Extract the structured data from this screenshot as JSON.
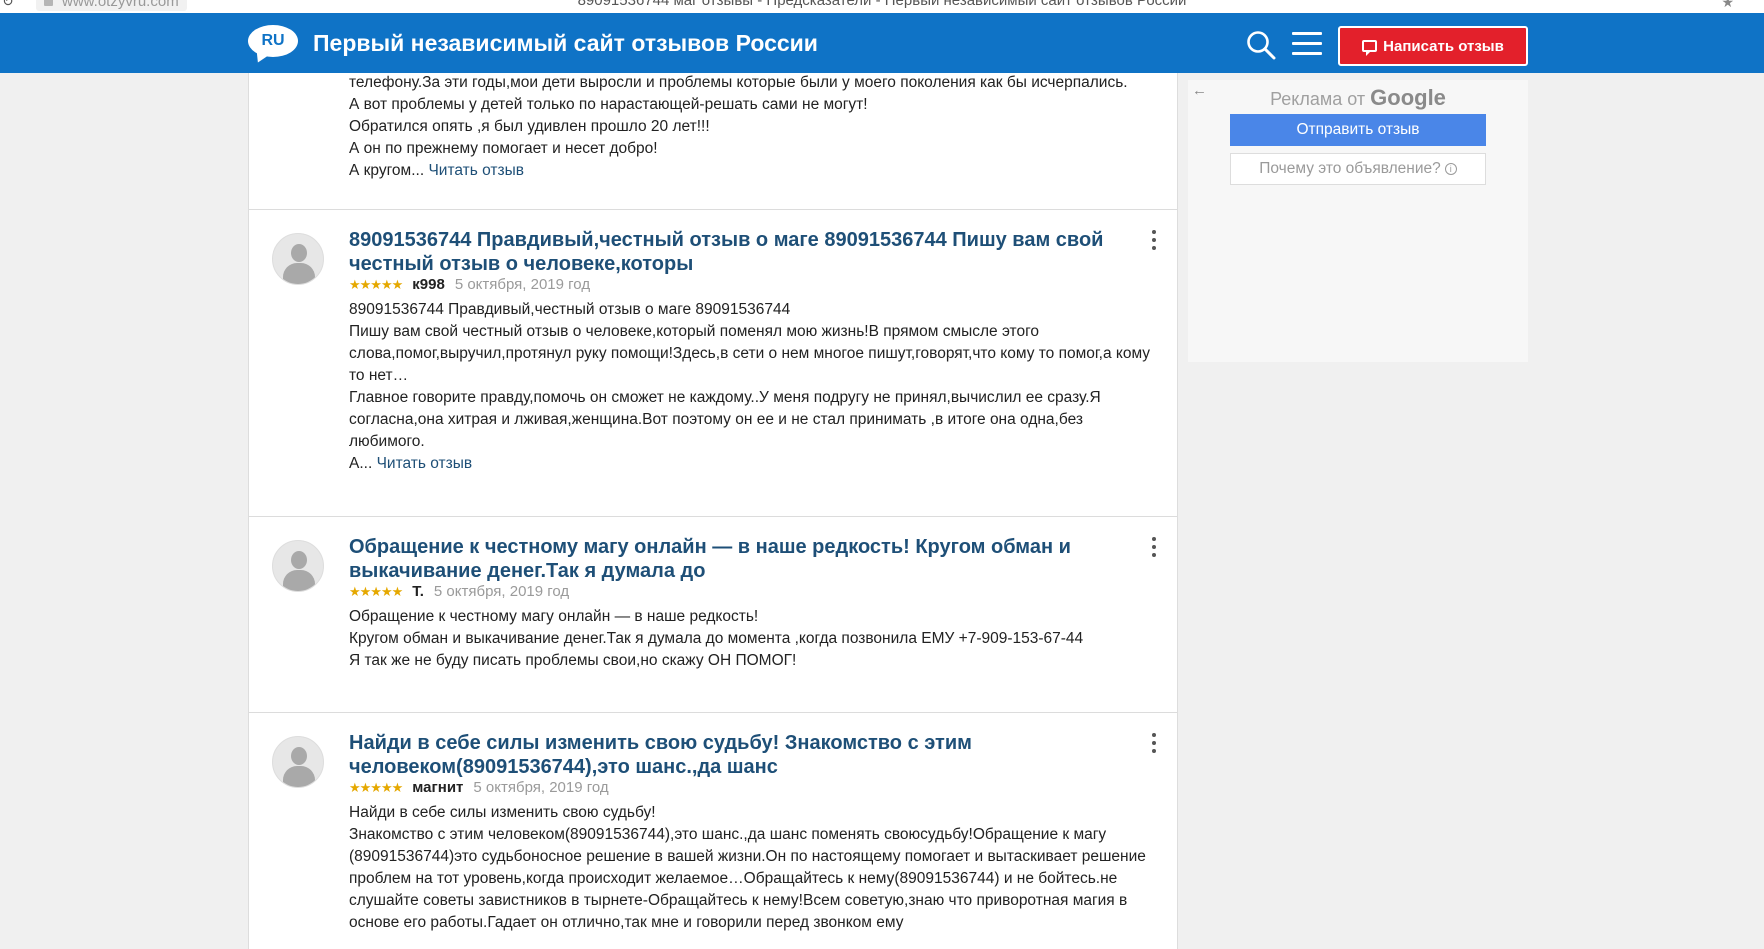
{
  "browser": {
    "url": "www.otzyvru.com",
    "window_title": "89091536744 маг отзывы - Предсказатели - Первый независимый сайт отзывов России"
  },
  "header": {
    "logo_text": "RU",
    "site_title": "Первый независимый сайт отзывов России",
    "write_review_label": "Написать отзыв"
  },
  "reviews": [
    {
      "lines": [
        "телефону.За эти годы,мои дети выросли и проблемы которые были у моего поколения как бы исчерпались.",
        "А вот проблемы у детей только по нарастающей-решать сами не могут!",
        "Обратился опять ,я был удивлен прошло 20 лет!!!",
        "А он по прежнему помогает и несет добро!"
      ],
      "last_line": "А кругом...",
      "read_more": "Читать отзыв"
    },
    {
      "title": "89091536744 Правдивый,честный отзыв о маге 89091536744 Пишу вам свой честный отзыв о человеке,которы",
      "stars": "★★★★★",
      "author": "к998",
      "date": "5 октября, 2019 год",
      "lines": [
        "89091536744 Правдивый,честный отзыв о маге 89091536744",
        "Пишу вам свой честный отзыв о человеке,который поменял мою жизнь!В прямом смысле этого слова,помог,выручил,протянул руку помощи!Здесь,в сети о нем многое пишут,говорят,что кому то помог,а кому то нет…",
        "Главное говорите правду,помочь он сможет не каждому..У меня подругу не принял,вычислил ее сразу.Я согласна,она хитрая и лживая,женщина.Вот поэтому он ее и не стал принимать ,в итоге она одна,без любимого."
      ],
      "last_line": "А...",
      "read_more": "Читать отзыв"
    },
    {
      "title": "Обращение к честному магу онлайн — в наше редкость! Кругом обман и выкачивание денег.Так я думала до",
      "stars": "★★★★★",
      "author": "Т.",
      "date": "5 октября, 2019 год",
      "lines": [
        "Обращение к честному магу онлайн — в наше редкость!",
        "Кругом обман и выкачивание денег.Так я думала до момента ,когда позвонила ЕМУ +7-909-153-67-44",
        "Я так же не буду писать проблемы свои,но скажу ОН ПОМОГ!"
      ]
    },
    {
      "title": "Найди в себе силы изменить свою судьбу! Знакомство с этим человеком(89091536744),это шанс.,да шанс",
      "stars": "★★★★★",
      "author": "магнит",
      "date": "5 октября, 2019 год",
      "lines": [
        "Найди в себе силы изменить свою судьбу!",
        "Знакомство с этим человеком(89091536744),это шанс.,да шанс поменять своюсудьбу!Обращение к магу (89091536744)это судьбоносное решение в вашей жизни.Он по настоящему помогает и вытаскивает решение проблем на тот уровень,когда происходит желаемое…Обращайтесь к нему(89091536744) и не бойтесь.не слушайте советы завистников в тырнете-Обращайтесь к нему!Всем советую,знаю что приворотная магия в основе его работы.Гадает он отлично,так мне и говорили перед звонком ему"
      ]
    }
  ],
  "ad": {
    "label_prefix": "Реклама от",
    "label_brand": "Google",
    "send_feedback": "Отправить отзыв",
    "why_this_ad": "Почему это объявление?"
  },
  "colors": {
    "header_blue": "#0f73c6",
    "write_button_red": "#e3202b",
    "title_blue": "#1e4f77",
    "ad_button_blue": "#4a86e8",
    "star_gold": "#e5a800"
  }
}
